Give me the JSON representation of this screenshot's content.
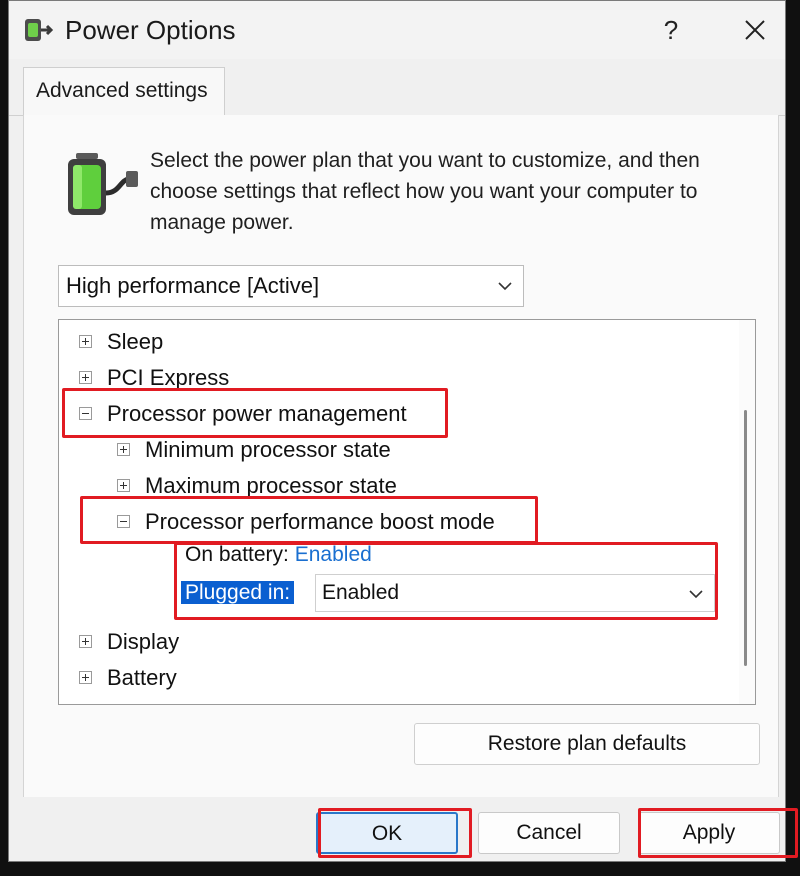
{
  "window": {
    "title": "Power Options",
    "help_label": "?",
    "tab_label": "Advanced settings"
  },
  "intro_text": "Select the power plan that you want to customize, and then choose settings that reflect how you want your computer to manage power.",
  "plan_select": {
    "value": "High performance [Active]"
  },
  "tree": {
    "sleep": "Sleep",
    "pci_express": "PCI Express",
    "processor_power_management": "Processor power management",
    "minimum_processor_state": "Minimum processor state",
    "maximum_processor_state": "Maximum processor state",
    "processor_performance_boost_mode": "Processor performance boost mode",
    "on_battery_label": "On battery:",
    "on_battery_value": "Enabled",
    "plugged_in_label": "Plugged in:",
    "plugged_in_value": "Enabled",
    "display": "Display",
    "battery": "Battery"
  },
  "buttons": {
    "restore": "Restore plan defaults",
    "ok": "OK",
    "cancel": "Cancel",
    "apply": "Apply"
  },
  "colors": {
    "highlight": "#e11b22",
    "selection": "#0a5fd0",
    "link_value": "#1a6fd0"
  },
  "icons": {
    "app": "power-options-icon",
    "help": "help-icon",
    "close": "close-icon",
    "battery": "battery-plug-icon",
    "dropdown": "chevron-down-icon",
    "expand": "plus-box-icon",
    "collapse": "minus-box-icon"
  }
}
